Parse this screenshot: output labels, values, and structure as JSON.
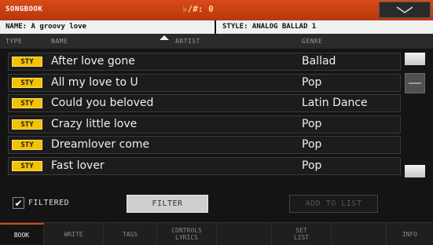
{
  "titlebar": {
    "title": "SONGBOOK",
    "transpose": "♭/#: 0",
    "menu_icon": "chevron-down-icon"
  },
  "info": {
    "name": "NAME: A groovy love",
    "style": "STYLE: ANALOG BALLAD 1"
  },
  "columns": {
    "type": "TYPE",
    "name": "NAME",
    "artist": "ARTIST",
    "genre": "GENRE"
  },
  "rows": [
    {
      "type": "STY",
      "name": "After love gone",
      "genre": "Ballad"
    },
    {
      "type": "STY",
      "name": "All my love to U",
      "genre": "Pop"
    },
    {
      "type": "STY",
      "name": "Could you beloved",
      "genre": "Latin Dance"
    },
    {
      "type": "STY",
      "name": "Crazy little love",
      "genre": "Pop"
    },
    {
      "type": "STY",
      "name": "Dreamlover come",
      "genre": "Pop"
    },
    {
      "type": "STY",
      "name": "Fast lover",
      "genre": "Pop"
    }
  ],
  "controls": {
    "filtered_label": "FILTERED",
    "filtered_checked": true,
    "filter_button": "FILTER",
    "add_to_list_button": "ADD TO LIST"
  },
  "tabs": {
    "book": "BOOK",
    "write": "WRITE",
    "tags": "TAGS",
    "controls_1": "CONTROLS",
    "controls_2": "LYRICS",
    "set_1": "SET",
    "set_2": "LIST",
    "info": "INFO",
    "active": "BOOK"
  },
  "colors": {
    "title_accent": "#d94a1a",
    "type_badge": "#f3c200"
  }
}
